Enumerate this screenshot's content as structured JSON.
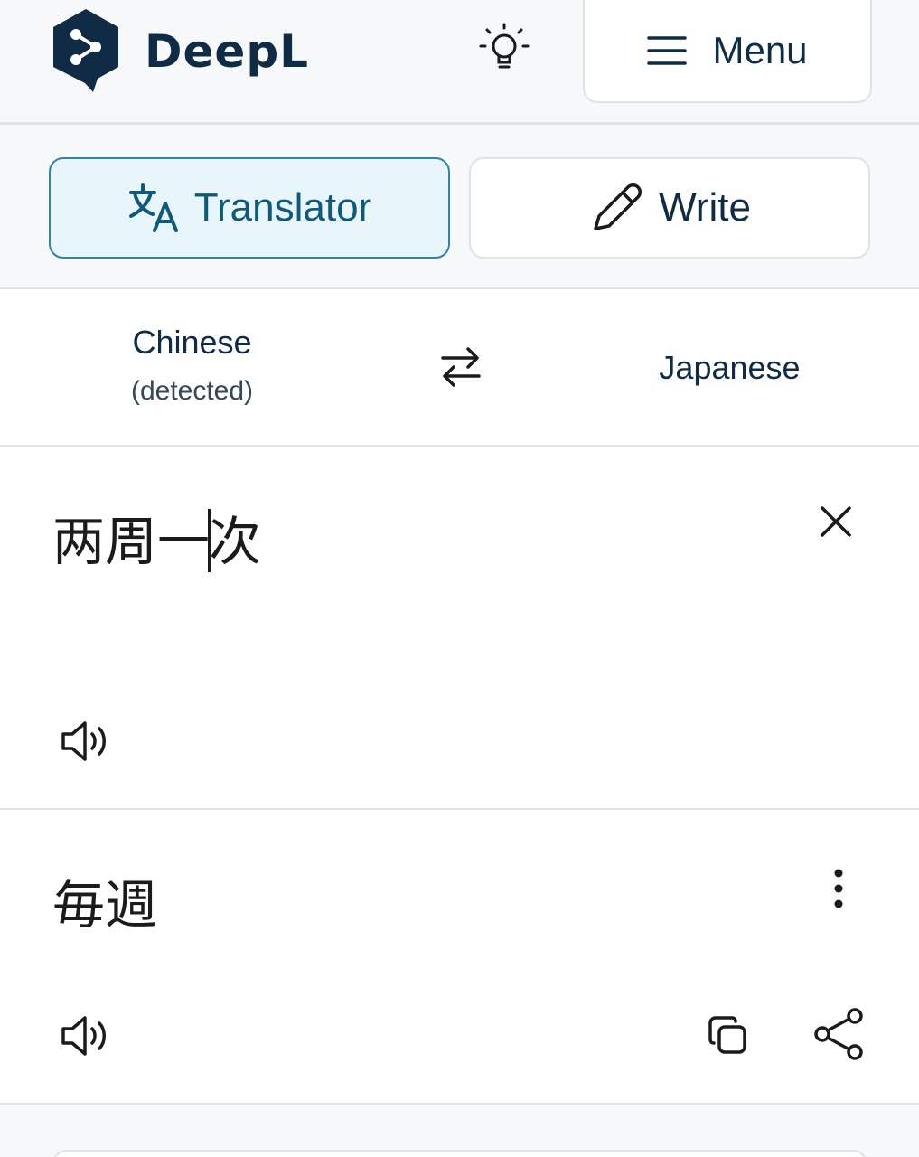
{
  "header": {
    "brand": "DeepL",
    "menu_label": "Menu",
    "icons": {
      "logo": "deepl-logo-icon",
      "bulb": "lightbulb-icon",
      "menu": "hamburger-icon"
    }
  },
  "tabs": [
    {
      "label": "Translator",
      "icon": "translate-icon",
      "active": true
    },
    {
      "label": "Write",
      "icon": "pencil-icon",
      "active": false
    }
  ],
  "languages": {
    "source": "Chinese",
    "source_note": "(detected)",
    "target": "Japanese",
    "swap_icon": "swap-arrows-icon"
  },
  "source_panel": {
    "text_before_caret": "两周一",
    "text_after_caret": "次",
    "icons": {
      "clear": "close-icon",
      "speak": "speaker-icon"
    }
  },
  "target_panel": {
    "text": "毎週",
    "icons": {
      "more": "more-vertical-icon",
      "speak": "speaker-icon",
      "copy": "copy-icon",
      "share": "share-icon"
    }
  },
  "colors": {
    "brand_dark": "#0f2b46",
    "accent": "#2d86a8",
    "active_tab_bg": "#e8f6fb",
    "page_bg": "#f6f8fa",
    "border": "#dde3e8"
  }
}
